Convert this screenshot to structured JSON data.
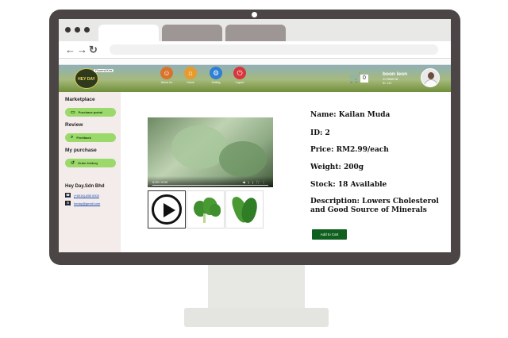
{
  "header": {
    "logo_text": "HEY DAY",
    "logo_badge": "Flowers&Kids",
    "nav": [
      {
        "label": "About Us",
        "icon": "people-icon",
        "color": "#d9742e"
      },
      {
        "label": "Home",
        "icon": "house-icon",
        "color": "#e89a2c"
      },
      {
        "label": "Setting",
        "icon": "gear-icon",
        "color": "#2e7fd6"
      },
      {
        "label": "Logout",
        "icon": "logout-icon",
        "color": "#d7363c"
      }
    ],
    "cart_count": "0",
    "user_name": "boon leon",
    "user_phone": "0178866708",
    "user_id": "ID: 124"
  },
  "sidebar": {
    "marketplace_heading": "Marketplace",
    "purchase_portal": "Purchase portal",
    "review_heading": "Review",
    "feedback": "Feedback",
    "my_purchase_heading": "My purchase",
    "order_history": "Order history",
    "company_name": "Hey Day.Sdn Bhd",
    "phone": "(+6016)-858 0000",
    "email": "heday@gmail.com"
  },
  "video": {
    "time": "0:03 / 0:03"
  },
  "product": {
    "name": "Name: Kailan Muda",
    "id": "ID: 2",
    "price": "Price: RM2.99/each",
    "weight": "Weight: 200g",
    "stock": "Stock: 18 Available",
    "description": "Description: Lowers Cholesterol and Good Source of Minerals",
    "add_to_cart": "Add to Cart"
  },
  "colors": {
    "accent_green": "#9ad96a",
    "button_green": "#0f5f1e",
    "monitor": "#4b4545"
  }
}
